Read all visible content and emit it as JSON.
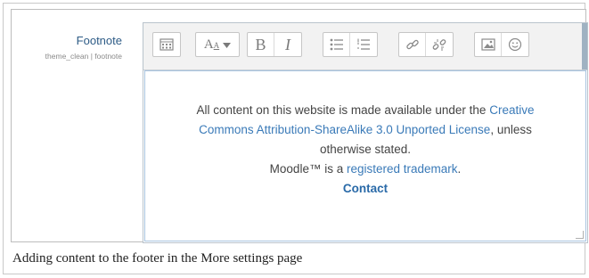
{
  "setting": {
    "title": "Footnote",
    "subtitle": "theme_clean | footnote"
  },
  "toolbar": {
    "groups": [
      [
        "toggle-toolbar-icon"
      ],
      [
        "font-size-icon"
      ],
      [
        "bold-icon",
        "italic-icon"
      ],
      [
        "bullet-list-icon",
        "numbered-list-icon"
      ],
      [
        "link-icon",
        "unlink-icon"
      ],
      [
        "image-icon",
        "emoticon-icon"
      ]
    ],
    "bold_label": "B",
    "italic_label": "I",
    "font_label": "A"
  },
  "content": {
    "line1_text": "All content on this website is made available under the",
    "line1_link": "Creative",
    "line2_link": "Commons Attribution-ShareAlike 3.0 Unported License",
    "line2_text": ", unless",
    "line3_text": "otherwise stated.",
    "line4_text": "Moodle™ is a",
    "line4_link": "registered trademark",
    "line4_end": ".",
    "contact": "Contact"
  },
  "caption": "Adding content to the footer in the More settings page",
  "colors": {
    "link": "#3a7ab8",
    "label": "#2d5b86",
    "toolbar_bg": "#f2f2f2"
  }
}
